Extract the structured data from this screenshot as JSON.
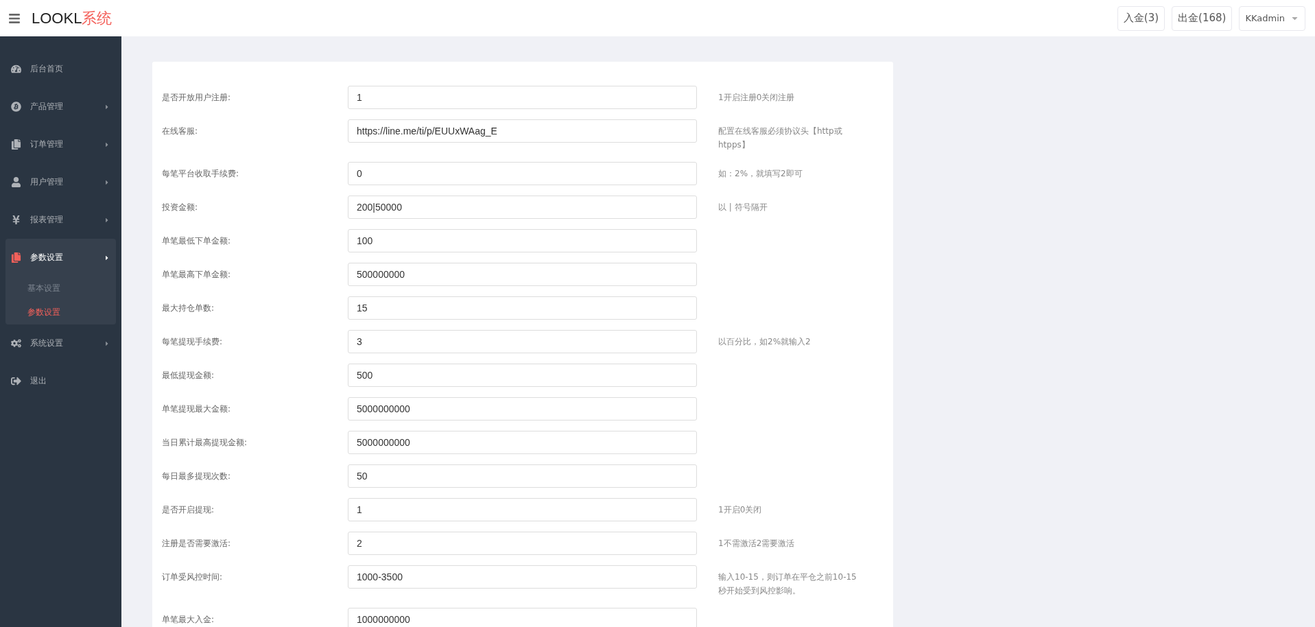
{
  "header": {
    "brand": "LOOKL",
    "brand_suffix": "系统",
    "buttons": [
      {
        "label": "入金(3)"
      },
      {
        "label": "出金(168)"
      }
    ],
    "user": "KKadmin"
  },
  "sidebar": {
    "items": [
      {
        "label": "后台首页",
        "kind": "link",
        "selected": false
      },
      {
        "label": "产品管理",
        "kind": "menu",
        "selected": false,
        "expanded": false
      },
      {
        "label": "订单管理",
        "kind": "menu",
        "selected": false,
        "expanded": false
      },
      {
        "label": "用户管理",
        "kind": "menu",
        "selected": false,
        "expanded": false
      },
      {
        "label": "报表管理",
        "kind": "menu",
        "selected": false,
        "expanded": false
      },
      {
        "label": "参数设置",
        "kind": "menu",
        "selected": true,
        "expanded": true,
        "children": [
          {
            "label": "基本设置",
            "selected": false
          },
          {
            "label": "参数设置",
            "selected": true
          }
        ]
      },
      {
        "label": "系统设置",
        "kind": "menu",
        "selected": false,
        "expanded": false
      },
      {
        "label": "退出",
        "kind": "link",
        "selected": false
      }
    ]
  },
  "form": {
    "fields": [
      {
        "label": "是否开放用户注册:",
        "value": "1",
        "hint": "1开启注册0关闭注册"
      },
      {
        "label": "在线客服:",
        "value": "https://line.me/ti/p/EUUxWAag_E",
        "hint": "配置在线客服必须协议头【http或htpps】"
      },
      {
        "label": "每笔平台收取手续费:",
        "value": "0",
        "hint": "如：2%，就填写2即可"
      },
      {
        "label": "投资金额:",
        "value": "200|50000",
        "hint": "以 | 符号隔开"
      },
      {
        "label": "单笔最低下单金额:",
        "value": "100"
      },
      {
        "label": "单笔最高下单金额:",
        "value": "500000000"
      },
      {
        "label": "最大持仓单数:",
        "value": "15"
      },
      {
        "label": "每笔提现手续费:",
        "value": "3",
        "hint": "以百分比，如2%就输入2"
      },
      {
        "label": "最低提现金额:",
        "value": "500"
      },
      {
        "label": "单笔提现最大金额:",
        "value": "5000000000"
      },
      {
        "label": "当日累计最高提现金额:",
        "value": "5000000000"
      },
      {
        "label": "每日最多提现次数:",
        "value": "50"
      },
      {
        "label": "是否开启提现:",
        "value": "1",
        "hint": "1开启0关闭"
      },
      {
        "label": "注册是否需要激活:",
        "value": "2",
        "hint": "1不需激活2需要激活"
      },
      {
        "label": "订单受风控时间:",
        "value": "1000-3500",
        "hint": "输入10-15，则订单在平仓之前10-15秒开始受到风控影响。"
      },
      {
        "label": "单笔最大入金:",
        "value": "1000000000"
      }
    ]
  }
}
